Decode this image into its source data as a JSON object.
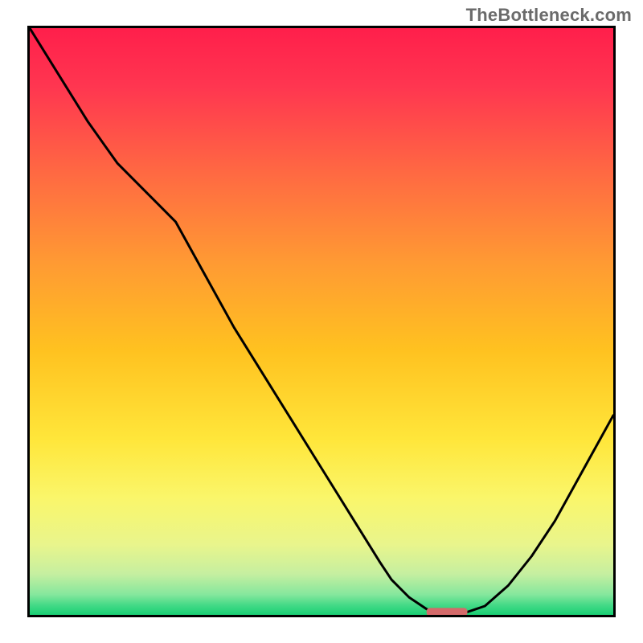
{
  "watermark": "TheBottleneck.com",
  "chart_data": {
    "type": "line",
    "title": "",
    "xlabel": "",
    "ylabel": "",
    "xlim": [
      0,
      100
    ],
    "ylim": [
      0,
      100
    ],
    "series": [
      {
        "name": "curve",
        "color": "#000000",
        "x": [
          0,
          5,
          10,
          15,
          20,
          25,
          30,
          35,
          40,
          45,
          50,
          55,
          60,
          62,
          65,
          68,
          70,
          72,
          75,
          78,
          82,
          86,
          90,
          95,
          100
        ],
        "y": [
          100,
          92,
          84,
          77,
          72,
          67,
          58,
          49,
          41,
          33,
          25,
          17,
          9,
          6,
          3,
          1,
          0,
          0.5,
          0.5,
          1.5,
          5,
          10,
          16,
          25,
          34
        ]
      },
      {
        "name": "flat-marker",
        "color": "#d46a6a",
        "x": [
          68,
          75
        ],
        "y": [
          0.5,
          0.5
        ]
      }
    ],
    "gradient_stops": [
      {
        "offset": 0.0,
        "color": "#ff1f4b"
      },
      {
        "offset": 0.1,
        "color": "#ff3650"
      },
      {
        "offset": 0.25,
        "color": "#ff6a42"
      },
      {
        "offset": 0.4,
        "color": "#ff9a33"
      },
      {
        "offset": 0.55,
        "color": "#ffc220"
      },
      {
        "offset": 0.7,
        "color": "#ffe63a"
      },
      {
        "offset": 0.8,
        "color": "#faf66a"
      },
      {
        "offset": 0.88,
        "color": "#e9f58c"
      },
      {
        "offset": 0.93,
        "color": "#c6efa0"
      },
      {
        "offset": 0.965,
        "color": "#86e79d"
      },
      {
        "offset": 0.985,
        "color": "#3fd985"
      },
      {
        "offset": 1.0,
        "color": "#19cf74"
      }
    ]
  }
}
